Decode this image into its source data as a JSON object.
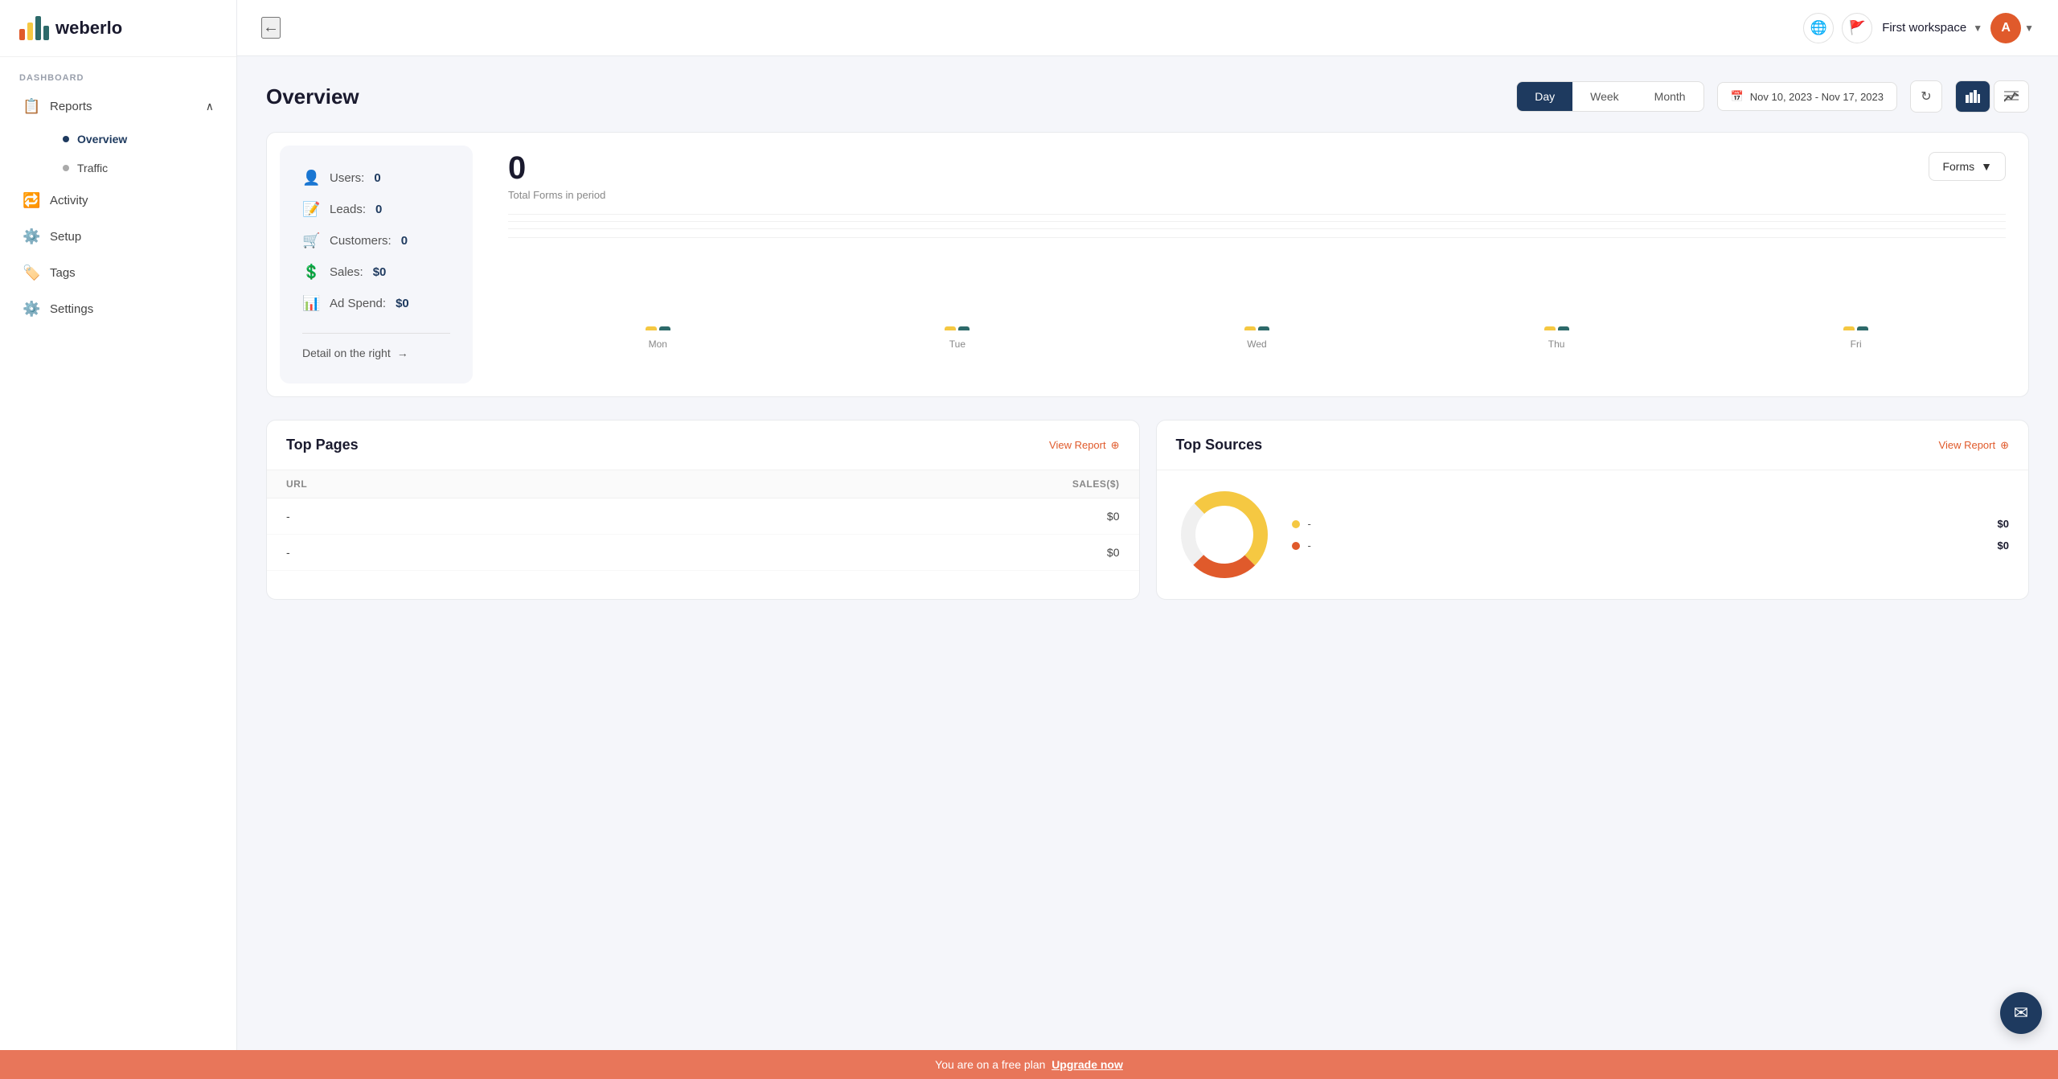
{
  "sidebar": {
    "logo_text": "weberlo",
    "section_label": "DASHBOARD",
    "nav_items": [
      {
        "id": "reports",
        "label": "Reports",
        "icon": "📋",
        "has_arrow": true,
        "active": false,
        "expanded": true
      },
      {
        "id": "activity",
        "label": "Activity",
        "icon": "🔁",
        "has_arrow": false,
        "active": false
      },
      {
        "id": "setup",
        "label": "Setup",
        "icon": "⚙️",
        "has_arrow": false,
        "active": false
      },
      {
        "id": "tags",
        "label": "Tags",
        "icon": "🏷️",
        "has_arrow": false,
        "active": false
      },
      {
        "id": "settings",
        "label": "Settings",
        "icon": "⚙️",
        "has_arrow": false,
        "active": false
      }
    ],
    "sub_items": [
      {
        "id": "overview",
        "label": "Overview",
        "active": true
      },
      {
        "id": "traffic",
        "label": "Traffic",
        "active": false
      }
    ]
  },
  "topbar": {
    "back_icon": "←",
    "globe_icon": "🌐",
    "flag_icon": "🚩",
    "workspace_name": "First workspace",
    "avatar_letter": "A"
  },
  "overview": {
    "title": "Overview",
    "period_buttons": [
      "Day",
      "Week",
      "Month"
    ],
    "active_period": "Day",
    "date_range": "Nov 10, 2023 - Nov 17, 2023",
    "chart_dropdown": "Forms",
    "total_number": "0",
    "total_label": "Total Forms in period",
    "stats": [
      {
        "id": "users",
        "label": "Users:",
        "value": "0",
        "icon": "👤"
      },
      {
        "id": "leads",
        "label": "Leads:",
        "value": "0",
        "icon": "📝"
      },
      {
        "id": "customers",
        "label": "Customers:",
        "value": "0",
        "icon": "🛒"
      },
      {
        "id": "sales",
        "label": "Sales:",
        "value": "$0",
        "icon": "💲"
      },
      {
        "id": "adspend",
        "label": "Ad Spend:",
        "value": "$0",
        "icon": "📊"
      }
    ],
    "detail_link": "Detail on the right",
    "bar_days": [
      "Mon",
      "Tue",
      "Wed",
      "Thu",
      "Fri"
    ],
    "bar_data": [
      {
        "day": "Mon",
        "v1": 5,
        "v2": 5
      },
      {
        "day": "Tue",
        "v1": 5,
        "v2": 5
      },
      {
        "day": "Wed",
        "v1": 5,
        "v2": 5
      },
      {
        "day": "Thu",
        "v1": 5,
        "v2": 5
      },
      {
        "day": "Fri",
        "v1": 5,
        "v2": 5
      }
    ]
  },
  "top_pages": {
    "title": "Top Pages",
    "view_report": "View Report",
    "col_url": "URL",
    "col_sales": "Sales($)",
    "rows": [
      {
        "url": "-",
        "sales": "$0"
      },
      {
        "url": "-",
        "sales": "$0"
      }
    ]
  },
  "top_sources": {
    "title": "Top Sources",
    "view_report": "View Report",
    "legend": [
      {
        "label": "-",
        "value": "$0",
        "color": "#f5c842"
      },
      {
        "label": "-",
        "value": "$0",
        "color": "#e05a2b"
      }
    ]
  },
  "banner": {
    "text": "You are on a free plan",
    "link_text": "Upgrade now"
  },
  "chat_icon": "✉"
}
